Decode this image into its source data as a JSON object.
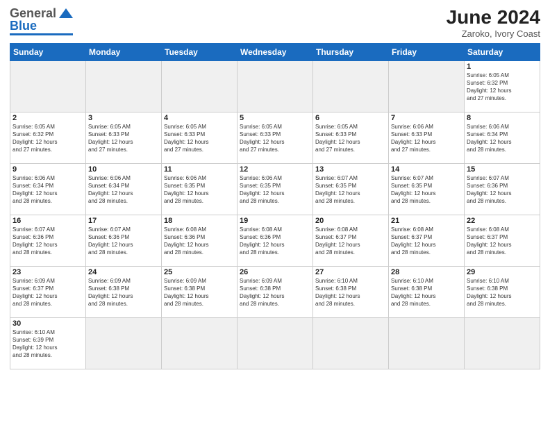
{
  "header": {
    "logo_general": "General",
    "logo_blue": "Blue",
    "month_year": "June 2024",
    "location": "Zaroko, Ivory Coast"
  },
  "weekdays": [
    "Sunday",
    "Monday",
    "Tuesday",
    "Wednesday",
    "Thursday",
    "Friday",
    "Saturday"
  ],
  "days": [
    {
      "num": "",
      "info": "",
      "empty": true
    },
    {
      "num": "",
      "info": "",
      "empty": true
    },
    {
      "num": "",
      "info": "",
      "empty": true
    },
    {
      "num": "",
      "info": "",
      "empty": true
    },
    {
      "num": "",
      "info": "",
      "empty": true
    },
    {
      "num": "",
      "info": "",
      "empty": true
    },
    {
      "num": "1",
      "info": "Sunrise: 6:05 AM\nSunset: 6:32 PM\nDaylight: 12 hours\nand 27 minutes."
    },
    {
      "num": "2",
      "info": "Sunrise: 6:05 AM\nSunset: 6:32 PM\nDaylight: 12 hours\nand 27 minutes."
    },
    {
      "num": "3",
      "info": "Sunrise: 6:05 AM\nSunset: 6:33 PM\nDaylight: 12 hours\nand 27 minutes."
    },
    {
      "num": "4",
      "info": "Sunrise: 6:05 AM\nSunset: 6:33 PM\nDaylight: 12 hours\nand 27 minutes."
    },
    {
      "num": "5",
      "info": "Sunrise: 6:05 AM\nSunset: 6:33 PM\nDaylight: 12 hours\nand 27 minutes."
    },
    {
      "num": "6",
      "info": "Sunrise: 6:05 AM\nSunset: 6:33 PM\nDaylight: 12 hours\nand 27 minutes."
    },
    {
      "num": "7",
      "info": "Sunrise: 6:06 AM\nSunset: 6:33 PM\nDaylight: 12 hours\nand 27 minutes."
    },
    {
      "num": "8",
      "info": "Sunrise: 6:06 AM\nSunset: 6:34 PM\nDaylight: 12 hours\nand 28 minutes."
    },
    {
      "num": "9",
      "info": "Sunrise: 6:06 AM\nSunset: 6:34 PM\nDaylight: 12 hours\nand 28 minutes."
    },
    {
      "num": "10",
      "info": "Sunrise: 6:06 AM\nSunset: 6:34 PM\nDaylight: 12 hours\nand 28 minutes."
    },
    {
      "num": "11",
      "info": "Sunrise: 6:06 AM\nSunset: 6:35 PM\nDaylight: 12 hours\nand 28 minutes."
    },
    {
      "num": "12",
      "info": "Sunrise: 6:06 AM\nSunset: 6:35 PM\nDaylight: 12 hours\nand 28 minutes."
    },
    {
      "num": "13",
      "info": "Sunrise: 6:07 AM\nSunset: 6:35 PM\nDaylight: 12 hours\nand 28 minutes."
    },
    {
      "num": "14",
      "info": "Sunrise: 6:07 AM\nSunset: 6:35 PM\nDaylight: 12 hours\nand 28 minutes."
    },
    {
      "num": "15",
      "info": "Sunrise: 6:07 AM\nSunset: 6:36 PM\nDaylight: 12 hours\nand 28 minutes."
    },
    {
      "num": "16",
      "info": "Sunrise: 6:07 AM\nSunset: 6:36 PM\nDaylight: 12 hours\nand 28 minutes."
    },
    {
      "num": "17",
      "info": "Sunrise: 6:07 AM\nSunset: 6:36 PM\nDaylight: 12 hours\nand 28 minutes."
    },
    {
      "num": "18",
      "info": "Sunrise: 6:08 AM\nSunset: 6:36 PM\nDaylight: 12 hours\nand 28 minutes."
    },
    {
      "num": "19",
      "info": "Sunrise: 6:08 AM\nSunset: 6:36 PM\nDaylight: 12 hours\nand 28 minutes."
    },
    {
      "num": "20",
      "info": "Sunrise: 6:08 AM\nSunset: 6:37 PM\nDaylight: 12 hours\nand 28 minutes."
    },
    {
      "num": "21",
      "info": "Sunrise: 6:08 AM\nSunset: 6:37 PM\nDaylight: 12 hours\nand 28 minutes."
    },
    {
      "num": "22",
      "info": "Sunrise: 6:08 AM\nSunset: 6:37 PM\nDaylight: 12 hours\nand 28 minutes."
    },
    {
      "num": "23",
      "info": "Sunrise: 6:09 AM\nSunset: 6:37 PM\nDaylight: 12 hours\nand 28 minutes."
    },
    {
      "num": "24",
      "info": "Sunrise: 6:09 AM\nSunset: 6:38 PM\nDaylight: 12 hours\nand 28 minutes."
    },
    {
      "num": "25",
      "info": "Sunrise: 6:09 AM\nSunset: 6:38 PM\nDaylight: 12 hours\nand 28 minutes."
    },
    {
      "num": "26",
      "info": "Sunrise: 6:09 AM\nSunset: 6:38 PM\nDaylight: 12 hours\nand 28 minutes."
    },
    {
      "num": "27",
      "info": "Sunrise: 6:10 AM\nSunset: 6:38 PM\nDaylight: 12 hours\nand 28 minutes."
    },
    {
      "num": "28",
      "info": "Sunrise: 6:10 AM\nSunset: 6:38 PM\nDaylight: 12 hours\nand 28 minutes."
    },
    {
      "num": "29",
      "info": "Sunrise: 6:10 AM\nSunset: 6:38 PM\nDaylight: 12 hours\nand 28 minutes."
    },
    {
      "num": "30",
      "info": "Sunrise: 6:10 AM\nSunset: 6:39 PM\nDaylight: 12 hours\nand 28 minutes."
    },
    {
      "num": "",
      "info": "",
      "empty": true
    },
    {
      "num": "",
      "info": "",
      "empty": true
    },
    {
      "num": "",
      "info": "",
      "empty": true
    },
    {
      "num": "",
      "info": "",
      "empty": true
    },
    {
      "num": "",
      "info": "",
      "empty": true
    },
    {
      "num": "",
      "info": "",
      "empty": true
    }
  ]
}
